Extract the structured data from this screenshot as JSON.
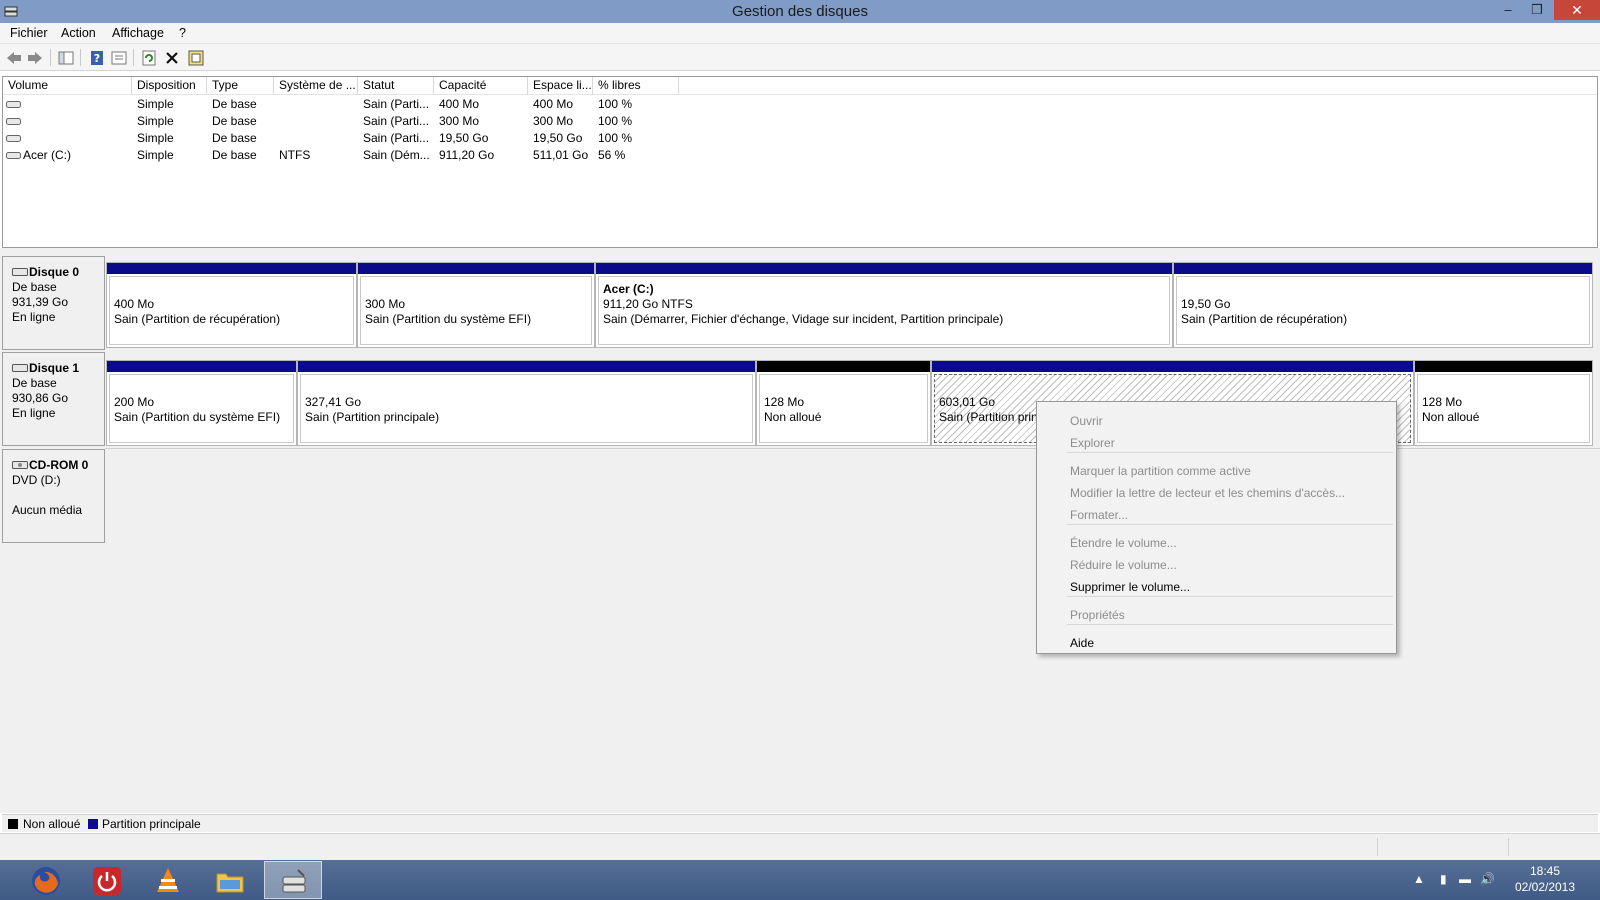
{
  "window": {
    "title": "Gestion des disques"
  },
  "menu": {
    "file": "Fichier",
    "action": "Action",
    "view": "Affichage",
    "help": "?"
  },
  "toolbar": [
    "back-icon",
    "forward-icon",
    "console-tree-icon",
    "help-icon",
    "properties-icon",
    "refresh-icon",
    "delete-icon",
    "settings-icon"
  ],
  "volumes": {
    "headers": [
      "Volume",
      "Disposition",
      "Type",
      "Système de ...",
      "Statut",
      "Capacité",
      "Espace li...",
      "% libres"
    ],
    "rows": [
      {
        "volume": "",
        "disposition": "Simple",
        "type": "De base",
        "fs": "",
        "status": "Sain (Parti...",
        "capacity": "400 Mo",
        "free": "400 Mo",
        "pct": "100 %"
      },
      {
        "volume": "",
        "disposition": "Simple",
        "type": "De base",
        "fs": "",
        "status": "Sain (Parti...",
        "capacity": "300 Mo",
        "free": "300 Mo",
        "pct": "100 %"
      },
      {
        "volume": "",
        "disposition": "Simple",
        "type": "De base",
        "fs": "",
        "status": "Sain (Parti...",
        "capacity": "19,50 Go",
        "free": "19,50 Go",
        "pct": "100 %"
      },
      {
        "volume": "Acer (C:)",
        "disposition": "Simple",
        "type": "De base",
        "fs": "NTFS",
        "status": "Sain (Dém...",
        "capacity": "911,20 Go",
        "free": "511,01 Go",
        "pct": "56 %"
      }
    ]
  },
  "disks": {
    "disk0": {
      "name": "Disque 0",
      "type": "De base",
      "size": "931,39 Go",
      "state": "En ligne",
      "partitions": [
        {
          "title": "",
          "size": "400 Mo",
          "status": "Sain (Partition de récupération)"
        },
        {
          "title": "",
          "size": "300 Mo",
          "status": "Sain (Partition du système EFI)"
        },
        {
          "title": "Acer  (C:)",
          "size": "911,20 Go NTFS",
          "status": "Sain (Démarrer, Fichier d'échange, Vidage sur incident, Partition principale)"
        },
        {
          "title": "",
          "size": "19,50 Go",
          "status": "Sain (Partition de récupération)"
        }
      ]
    },
    "disk1": {
      "name": "Disque 1",
      "type": "De base",
      "size": "930,86 Go",
      "state": "En ligne",
      "partitions": [
        {
          "size": "200 Mo",
          "status": "Sain (Partition du système EFI)"
        },
        {
          "size": "327,41 Go",
          "status": "Sain (Partition principale)"
        },
        {
          "size": "128 Mo",
          "status": "Non alloué"
        },
        {
          "size": "603,01 Go",
          "status": "Sain (Partition principale)"
        },
        {
          "size": "128 Mo",
          "status": "Non alloué"
        }
      ]
    },
    "cdrom": {
      "name": "CD-ROM 0",
      "drive": "DVD (D:)",
      "media": "Aucun média"
    }
  },
  "legend": {
    "unallocated": "Non alloué",
    "primary": "Partition principale",
    "colors": {
      "unallocated": "#000000",
      "primary": "#0a0a8a"
    }
  },
  "context_menu": {
    "open": "Ouvrir",
    "explore": "Explorer",
    "mark_active": "Marquer la partition comme active",
    "change_letter": "Modifier la lettre de lecteur et les chemins d'accès...",
    "format": "Formater...",
    "extend": "Étendre le volume...",
    "shrink": "Réduire le volume...",
    "delete": "Supprimer le volume...",
    "properties": "Propriétés",
    "help": "Aide"
  },
  "taskbar": {
    "apps": [
      "firefox-icon",
      "power-icon",
      "vlc-icon",
      "file-explorer-icon",
      "disk-management-icon"
    ],
    "time": "18:45",
    "date": "02/02/2013"
  }
}
